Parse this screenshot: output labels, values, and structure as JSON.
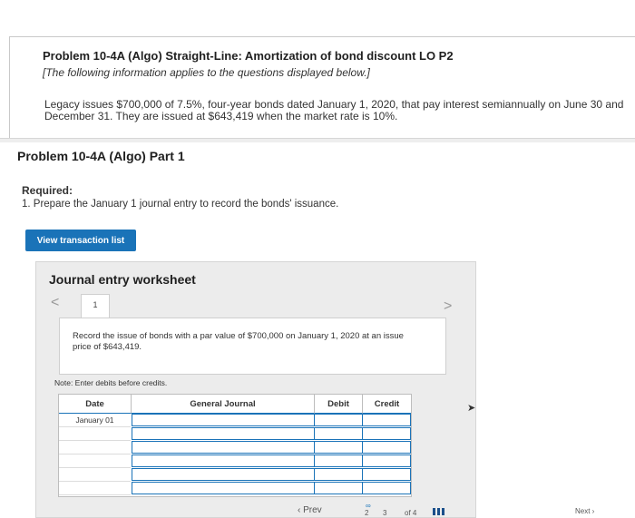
{
  "problem": {
    "title": "Problem 10-4A (Algo) Straight-Line: Amortization of bond discount LO P2",
    "intro_note": "[The following information applies to the questions displayed below.]",
    "body": "Legacy issues $700,000 of 7.5%, four-year bonds dated January 1, 2020, that pay interest semiannually on June 30 and December 31. They are issued at $643,419 when the market rate is 10%."
  },
  "part": {
    "title": "Problem 10-4A (Algo) Part 1",
    "required_label": "Required:",
    "required_text": "1. Prepare the January 1 journal entry to record the bonds' issuance."
  },
  "view_transactions_label": "View transaction list",
  "worksheet": {
    "title": "Journal entry worksheet",
    "prev_arrow": "<",
    "next_arrow": ">",
    "entry_tab": "1",
    "description": "Record the issue of bonds with a par value of $700,000 on January 1, 2020 at an issue price of $643,419.",
    "note": "Note: Enter debits before credits.",
    "columns": [
      "Date",
      "General Journal",
      "Debit",
      "Credit"
    ],
    "rows": [
      {
        "date": "January 01"
      },
      {
        "date": ""
      },
      {
        "date": ""
      },
      {
        "date": ""
      },
      {
        "date": ""
      },
      {
        "date": ""
      }
    ]
  },
  "pagination": {
    "prev": "‹ Prev",
    "current": "2",
    "next_page": "3",
    "of_label": "of 4",
    "next": "Next ›"
  }
}
